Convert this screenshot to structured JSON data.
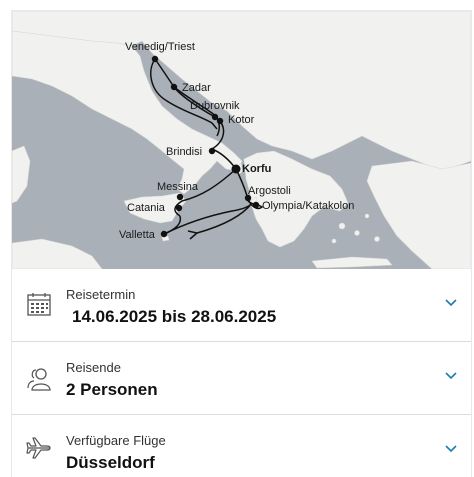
{
  "map": {
    "ports": [
      {
        "name": "Venedig/Triest"
      },
      {
        "name": "Zadar"
      },
      {
        "name": "Dubrovnik"
      },
      {
        "name": "Kotor"
      },
      {
        "name": "Brindisi"
      },
      {
        "name": "Korfu"
      },
      {
        "name": "Messina"
      },
      {
        "name": "Argostoli"
      },
      {
        "name": "Catania"
      },
      {
        "name": "Olympia/Katakolon"
      },
      {
        "name": "Valletta"
      }
    ],
    "route_color": "#111111",
    "land_color": "#f1f1ef",
    "sea_color": "#aab0b8"
  },
  "travel_date": {
    "label": "Reisetermin",
    "value": "14.06.2025 bis 28.06.2025",
    "icon": "calendar-icon"
  },
  "travellers": {
    "label": "Reisende",
    "value": "2 Personen",
    "icon": "persons-icon"
  },
  "flights": {
    "label": "Verfügbare Flüge",
    "value": "Düsseldorf",
    "icon": "airplane-icon"
  },
  "accent_color": "#1a7fb0"
}
